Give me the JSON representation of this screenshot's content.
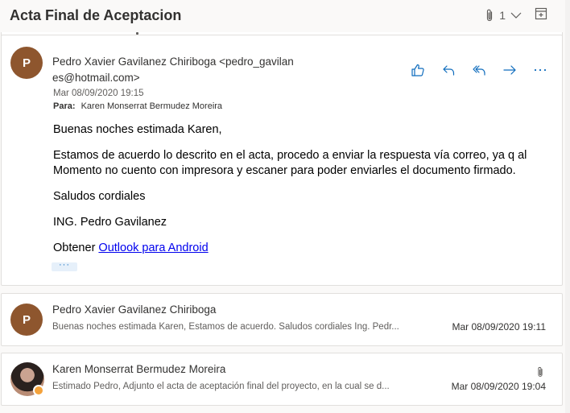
{
  "header": {
    "subject": "Acta Final de Aceptacion",
    "attachment_count": "1"
  },
  "thread": {
    "expanded": {
      "avatar_initial": "P",
      "sender_line1": "Pedro Xavier Gavilanez Chiriboga <pedro_gavilan",
      "sender_line2": "es@hotmail.com>",
      "date": "Mar 08/09/2020 19:15",
      "to_label": "Para:",
      "to_value": "Karen Monserrat Bermudez Moreira",
      "body": {
        "p1": "Buenas noches estimada Karen,",
        "p2": "Estamos de acuerdo lo descrito en el acta, procedo a enviar la respuesta vía correo, ya q al Momento no cuento con impresora y escaner para poder enviarles el documento firmado.",
        "p3": "Saludos cordiales",
        "p4": "ING. Pedro Gavilanez",
        "p5_prefix": "Obtener ",
        "p5_link": "Outlook para Android"
      },
      "more_label": "···"
    },
    "collapsed": [
      {
        "avatar_initial": "P",
        "sender": "Pedro Xavier Gavilanez Chiriboga",
        "preview": "Buenas noches estimada Karen, Estamos de acuerdo. Saludos cordiales Ing. Pedr...",
        "date": "Mar 08/09/2020 19:11"
      },
      {
        "sender": "Karen Monserrat Bermudez Moreira",
        "preview": "Estimado Pedro, Adjunto el acta de aceptación final del proyecto, en la cual se d...",
        "date": "Mar 08/09/2020 19:04"
      }
    ]
  },
  "icons": {
    "attachment": "paperclip-icon",
    "expand": "chevron-down-icon",
    "popout": "open-in-new-window-icon",
    "like": "thumbs-up-icon",
    "reply": "reply-icon",
    "reply_all": "reply-all-icon",
    "forward": "forward-icon",
    "more": "more-options-icon"
  },
  "colors": {
    "accent": "#0f6cbd",
    "avatar": "#8e562e",
    "status_away": "#f4a23b"
  }
}
